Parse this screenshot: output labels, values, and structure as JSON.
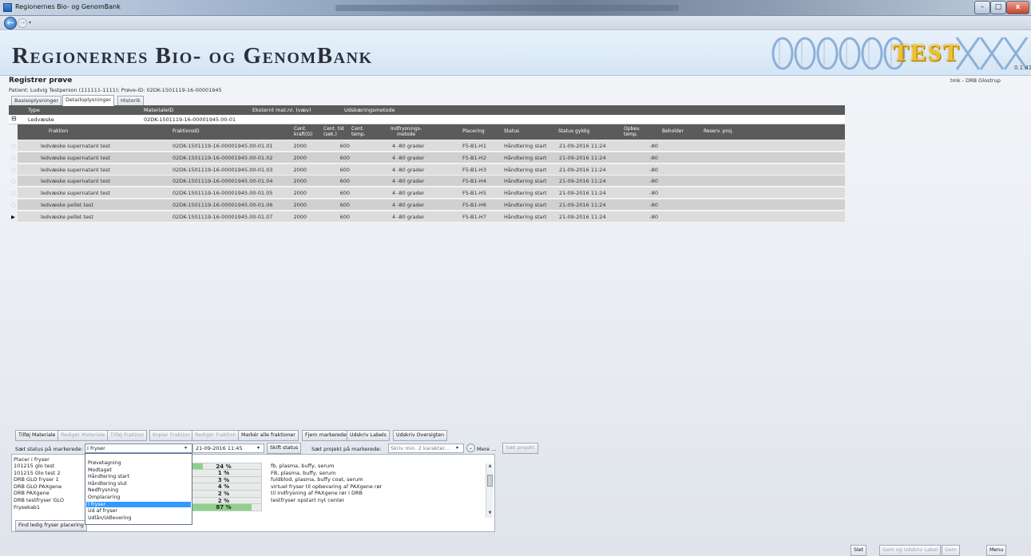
{
  "window": {
    "title": "Regionernes Bio- og GenomBank",
    "minimize": "–",
    "maximize": "□",
    "close": "x"
  },
  "nav": {
    "back": "←",
    "forward": "→",
    "dropdown": "▾"
  },
  "banner": {
    "heading": "Regionernes Bio- og GenomBank",
    "badge": "TEST",
    "version": "0.1.41"
  },
  "header": {
    "page_title": "Registrer prøve",
    "patient_info": "Patient: Ludvig Testperson (111111-1111); Prøve-ID: 02DK-1501119-16-00001945",
    "user_info": "tmk - DRB Glostrup"
  },
  "tabs": [
    "Basisoplysninger",
    "Detailoplysninger",
    "Historik"
  ],
  "grid": {
    "parent_columns": [
      "Type",
      "MaterialeID",
      "Eksternt mat.nr. (væv)",
      "Udskæringsmetode"
    ],
    "expander": "⊟",
    "parent_row": {
      "type": "Ledvæske",
      "materiale_id": "02DK-1501119-16-00001945.00-01"
    },
    "child_columns": [
      "Fraktion",
      "FraktionsID",
      "Cent. kraft(G)",
      "Cent. tid (sek.)",
      "Cent. temp.",
      "Indfrysnings-metode",
      "Placering",
      "Status",
      "Status gyldig",
      "Opbev. temp.",
      "Beholder",
      "Reserv. proj."
    ],
    "rows": [
      {
        "fraktion": "ledvæske supernatant test",
        "id": "02DK-1501119-16-00001945.00-01.01",
        "kraft": "2000",
        "tid": "600",
        "metode": "4 -80 grader",
        "placering": "F5-B1-H1",
        "status": "Håndtering start",
        "gyldig": "21-09-2016 11:24",
        "temp": "-80"
      },
      {
        "fraktion": "ledvæske supernatant test",
        "id": "02DK-1501119-16-00001945.00-01.02",
        "kraft": "2000",
        "tid": "600",
        "metode": "4 -80 grader",
        "placering": "F5-B1-H2",
        "status": "Håndtering start",
        "gyldig": "21-09-2016 11:24",
        "temp": "-80"
      },
      {
        "fraktion": "ledvæske supernatant test",
        "id": "02DK-1501119-16-00001945.00-01.03",
        "kraft": "2000",
        "tid": "600",
        "metode": "4 -80 grader",
        "placering": "F5-B1-H3",
        "status": "Håndtering start",
        "gyldig": "21-09-2016 11:24",
        "temp": "-80"
      },
      {
        "fraktion": "ledvæske supernatant test",
        "id": "02DK-1501119-16-00001945.00-01.04",
        "kraft": "2000",
        "tid": "600",
        "metode": "4 -80 grader",
        "placering": "F5-B1-H4",
        "status": "Håndtering start",
        "gyldig": "21-09-2016 11:24",
        "temp": "-80"
      },
      {
        "fraktion": "ledvæske supernatant test",
        "id": "02DK-1501119-16-00001945.00-01.05",
        "kraft": "2000",
        "tid": "600",
        "metode": "4 -80 grader",
        "placering": "F5-B1-H5",
        "status": "Håndtering start",
        "gyldig": "21-09-2016 11:24",
        "temp": "-80"
      },
      {
        "fraktion": "ledvæske pellet test",
        "id": "02DK-1501119-16-00001945.00-01.06",
        "kraft": "2000",
        "tid": "600",
        "metode": "4 -80 grader",
        "placering": "F5-B1-H6",
        "status": "Håndtering start",
        "gyldig": "21-09-2016 11:24",
        "temp": "-80"
      },
      {
        "fraktion": "ledvæske pellet test",
        "id": "02DK-1501119-16-00001945.00-01.07",
        "kraft": "2000",
        "tid": "600",
        "metode": "4 -80 grader",
        "placering": "F5-B1-H7",
        "status": "Håndtering start",
        "gyldig": "21-09-2016 11:24",
        "temp": "-80"
      }
    ],
    "row_marker": "▶",
    "row_marker_empty": "○"
  },
  "toolbar": {
    "buttons": [
      "Tilføj Materiale",
      "Redigér Materiale",
      "Tilføj Fraktion",
      "Kopier Fraktion",
      "Redigér Fraktion",
      "Markér alle fraktioner",
      "Fjern markerede",
      "Udskriv Labels",
      "Udskriv Oversigten"
    ],
    "disabled": [
      false,
      true,
      true,
      true,
      true,
      false,
      false,
      false,
      false
    ]
  },
  "status_row": {
    "label": "Sæt status på markerede:",
    "selected": "I fryser",
    "date": "21-09-2016 11:45",
    "skift": "Skift status",
    "project_label": "Sæt projekt på markerede:",
    "project_placeholder": "Skriv min. 2 karakter...",
    "more": "Mere ...",
    "saet_projekt": "Sæt projekt",
    "arrow": "▾",
    "chevron": "⌄"
  },
  "status_options": [
    "Prøvetagning",
    "Modtaget",
    "Håndtering start",
    "Håndtering slut",
    "Nedfrysning",
    "Omplacering",
    "I fryser",
    "Ud af fryser",
    "Udlån/Udlevering"
  ],
  "freezers": {
    "label": "Placer i fryser",
    "items": [
      {
        "name": "101215 glo test",
        "pct": "24 %",
        "fill": 0.24,
        "desc": "fb, plasma, buffy, serum"
      },
      {
        "name": "101215 Glo test 2",
        "pct": "1 %",
        "fill": 0.01,
        "desc": "FB, plasma, buffy, serum"
      },
      {
        "name": "DRB GLO fryser 1",
        "pct": "3 %",
        "fill": 0.03,
        "desc": "fuldblod, plasma, buffy coat, serum"
      },
      {
        "name": "DRB GLO PAXgene",
        "pct": "4 %",
        "fill": 0.04,
        "desc": "virtuel fryser til opbevaring af PAXgene rør"
      },
      {
        "name": "DRB PAXgene",
        "pct": "2 %",
        "fill": 0.02,
        "desc": "til indfrysning af PAXgene rør i DRB"
      },
      {
        "name": "DRB testfryser GLO",
        "pct": "2 %",
        "fill": 0.02,
        "desc": "testfryser opstart nyt center"
      },
      {
        "name": "Frysekab1",
        "pct": "87 %",
        "fill": 0.87,
        "desc": ""
      }
    ],
    "find_button": "Find ledig fryser placering",
    "scroll_up": "▲",
    "scroll_down": "▼"
  },
  "bottom": {
    "slet": "Slet",
    "gem_udskriv": "Gem og Udskriv Label",
    "gem": "Gem",
    "menu": "Menu"
  },
  "colors": {
    "grid_header": "#5b5b5b",
    "selection": "#3399ff",
    "badge": "#f2c027"
  }
}
